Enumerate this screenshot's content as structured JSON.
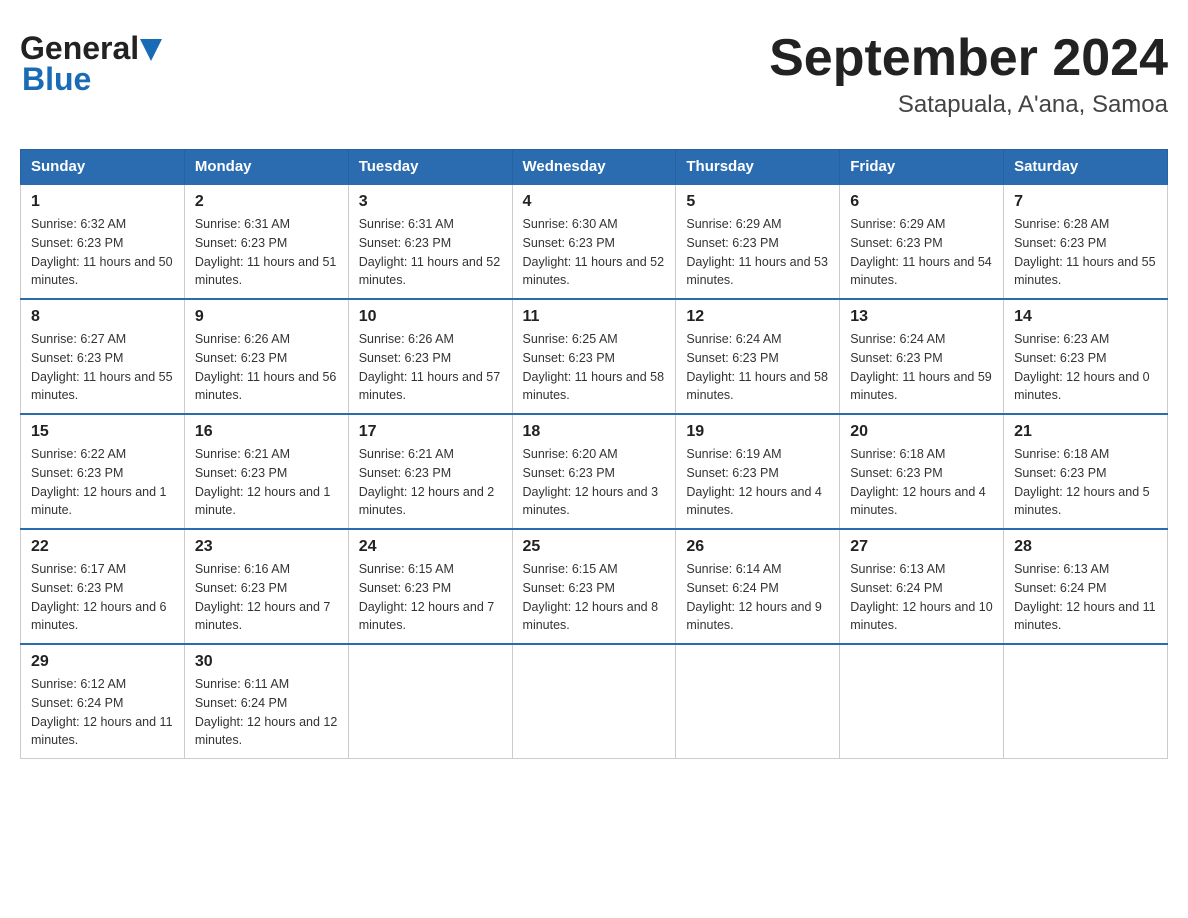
{
  "header": {
    "logo_general": "General",
    "logo_blue": "Blue",
    "title": "September 2024",
    "subtitle": "Satapuala, A'ana, Samoa"
  },
  "days_of_week": [
    "Sunday",
    "Monday",
    "Tuesday",
    "Wednesday",
    "Thursday",
    "Friday",
    "Saturday"
  ],
  "weeks": [
    [
      {
        "day": "1",
        "sunrise": "6:32 AM",
        "sunset": "6:23 PM",
        "daylight": "11 hours and 50 minutes."
      },
      {
        "day": "2",
        "sunrise": "6:31 AM",
        "sunset": "6:23 PM",
        "daylight": "11 hours and 51 minutes."
      },
      {
        "day": "3",
        "sunrise": "6:31 AM",
        "sunset": "6:23 PM",
        "daylight": "11 hours and 52 minutes."
      },
      {
        "day": "4",
        "sunrise": "6:30 AM",
        "sunset": "6:23 PM",
        "daylight": "11 hours and 52 minutes."
      },
      {
        "day": "5",
        "sunrise": "6:29 AM",
        "sunset": "6:23 PM",
        "daylight": "11 hours and 53 minutes."
      },
      {
        "day": "6",
        "sunrise": "6:29 AM",
        "sunset": "6:23 PM",
        "daylight": "11 hours and 54 minutes."
      },
      {
        "day": "7",
        "sunrise": "6:28 AM",
        "sunset": "6:23 PM",
        "daylight": "11 hours and 55 minutes."
      }
    ],
    [
      {
        "day": "8",
        "sunrise": "6:27 AM",
        "sunset": "6:23 PM",
        "daylight": "11 hours and 55 minutes."
      },
      {
        "day": "9",
        "sunrise": "6:26 AM",
        "sunset": "6:23 PM",
        "daylight": "11 hours and 56 minutes."
      },
      {
        "day": "10",
        "sunrise": "6:26 AM",
        "sunset": "6:23 PM",
        "daylight": "11 hours and 57 minutes."
      },
      {
        "day": "11",
        "sunrise": "6:25 AM",
        "sunset": "6:23 PM",
        "daylight": "11 hours and 58 minutes."
      },
      {
        "day": "12",
        "sunrise": "6:24 AM",
        "sunset": "6:23 PM",
        "daylight": "11 hours and 58 minutes."
      },
      {
        "day": "13",
        "sunrise": "6:24 AM",
        "sunset": "6:23 PM",
        "daylight": "11 hours and 59 minutes."
      },
      {
        "day": "14",
        "sunrise": "6:23 AM",
        "sunset": "6:23 PM",
        "daylight": "12 hours and 0 minutes."
      }
    ],
    [
      {
        "day": "15",
        "sunrise": "6:22 AM",
        "sunset": "6:23 PM",
        "daylight": "12 hours and 1 minute."
      },
      {
        "day": "16",
        "sunrise": "6:21 AM",
        "sunset": "6:23 PM",
        "daylight": "12 hours and 1 minute."
      },
      {
        "day": "17",
        "sunrise": "6:21 AM",
        "sunset": "6:23 PM",
        "daylight": "12 hours and 2 minutes."
      },
      {
        "day": "18",
        "sunrise": "6:20 AM",
        "sunset": "6:23 PM",
        "daylight": "12 hours and 3 minutes."
      },
      {
        "day": "19",
        "sunrise": "6:19 AM",
        "sunset": "6:23 PM",
        "daylight": "12 hours and 4 minutes."
      },
      {
        "day": "20",
        "sunrise": "6:18 AM",
        "sunset": "6:23 PM",
        "daylight": "12 hours and 4 minutes."
      },
      {
        "day": "21",
        "sunrise": "6:18 AM",
        "sunset": "6:23 PM",
        "daylight": "12 hours and 5 minutes."
      }
    ],
    [
      {
        "day": "22",
        "sunrise": "6:17 AM",
        "sunset": "6:23 PM",
        "daylight": "12 hours and 6 minutes."
      },
      {
        "day": "23",
        "sunrise": "6:16 AM",
        "sunset": "6:23 PM",
        "daylight": "12 hours and 7 minutes."
      },
      {
        "day": "24",
        "sunrise": "6:15 AM",
        "sunset": "6:23 PM",
        "daylight": "12 hours and 7 minutes."
      },
      {
        "day": "25",
        "sunrise": "6:15 AM",
        "sunset": "6:23 PM",
        "daylight": "12 hours and 8 minutes."
      },
      {
        "day": "26",
        "sunrise": "6:14 AM",
        "sunset": "6:24 PM",
        "daylight": "12 hours and 9 minutes."
      },
      {
        "day": "27",
        "sunrise": "6:13 AM",
        "sunset": "6:24 PM",
        "daylight": "12 hours and 10 minutes."
      },
      {
        "day": "28",
        "sunrise": "6:13 AM",
        "sunset": "6:24 PM",
        "daylight": "12 hours and 11 minutes."
      }
    ],
    [
      {
        "day": "29",
        "sunrise": "6:12 AM",
        "sunset": "6:24 PM",
        "daylight": "12 hours and 11 minutes."
      },
      {
        "day": "30",
        "sunrise": "6:11 AM",
        "sunset": "6:24 PM",
        "daylight": "12 hours and 12 minutes."
      },
      null,
      null,
      null,
      null,
      null
    ]
  ],
  "labels": {
    "sunrise": "Sunrise:",
    "sunset": "Sunset:",
    "daylight": "Daylight:"
  }
}
